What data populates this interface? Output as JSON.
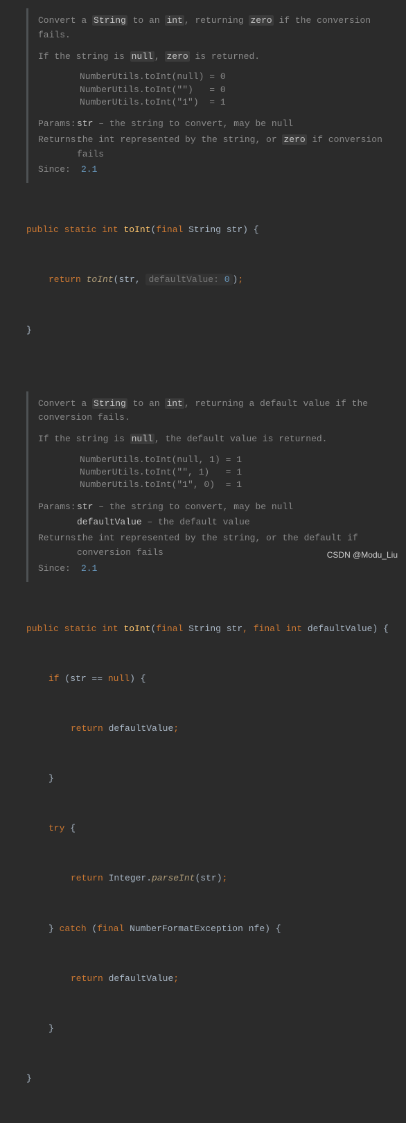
{
  "javadoc1": {
    "desc_a": "Convert a ",
    "desc_b": "String",
    "desc_c": " to an ",
    "desc_d": "int",
    "desc_e": ", returning ",
    "desc_f": "zero",
    "desc_g": " if the conversion fails.",
    "note_a": "If the string is ",
    "note_b": "null",
    "note_c": ", ",
    "note_d": "zero",
    "note_e": " is returned.",
    "codeblock": "NumberUtils.toInt(null) = 0\nNumberUtils.toInt(\"\")   = 0\nNumberUtils.toInt(\"1\")  = 1",
    "params_label": "Params:",
    "param_name": "str",
    "param_desc": " – the string to convert, may be null",
    "returns_label": "Returns:",
    "returns_a": "the int represented by the string, or ",
    "returns_b": "zero",
    "returns_c": " if conversion fails",
    "since_label": "Since:",
    "since_val": "2.1"
  },
  "method1": {
    "sig_public": "public",
    "sig_static": "static",
    "sig_int": "int",
    "sig_name": "toInt",
    "sig_paren_open": "(",
    "sig_final": "final",
    "sig_type": "String",
    "sig_param": "str",
    "sig_paren_close": ")",
    "sig_brace": " {",
    "ret_kw": "return",
    "ret_call": "toInt",
    "ret_open": "(",
    "ret_arg": "str",
    "ret_comma": ", ",
    "hint_label": "defaultValue:",
    "hint_val": "0",
    "ret_close": ")",
    "ret_semi": ";",
    "close_brace": "}"
  },
  "javadoc2": {
    "desc_a": "Convert a ",
    "desc_b": "String",
    "desc_c": " to an ",
    "desc_d": "int",
    "desc_e": ", returning a default value if the conversion fails.",
    "note_a": "If the string is ",
    "note_b": "null",
    "note_c": ", the default value is returned.",
    "codeblock": "NumberUtils.toInt(null, 1) = 1\nNumberUtils.toInt(\"\", 1)   = 1\nNumberUtils.toInt(\"1\", 0)  = 1",
    "params_label": "Params:",
    "param1_name": "str",
    "param1_desc": " – the string to convert, may be null",
    "param2_name": "defaultValue",
    "param2_desc": " – the default value",
    "returns_label": "Returns:",
    "returns_val": "the int represented by the string, or the default if conversion fails",
    "since_label": "Since:",
    "since_val": "2.1"
  },
  "method2": {
    "sig_public": "public",
    "sig_static": "static",
    "sig_int": "int",
    "sig_name": "toInt",
    "sig_paren_open": "(",
    "sig_final1": "final",
    "sig_type1": "String",
    "sig_param1": "str",
    "sig_comma": ",",
    "sig_final2": "final",
    "sig_type2": "int",
    "sig_param2": "defaultValue",
    "sig_paren_close": ")",
    "sig_brace": " {",
    "if_kw": "if",
    "if_open": " (",
    "if_var": "str",
    "if_eq": " == ",
    "if_null": "null",
    "if_close": ")",
    "if_brace": " {",
    "ret1_kw": "return",
    "ret1_val": "defaultValue",
    "ret1_semi": ";",
    "if_close_brace": "}",
    "try_kw": "try",
    "try_brace": " {",
    "ret2_kw": "return",
    "ret2_cls": "Integer",
    "ret2_dot": ".",
    "ret2_method": "parseInt",
    "ret2_open": "(",
    "ret2_arg": "str",
    "ret2_close": ")",
    "ret2_semi": ";",
    "try_close": "}",
    "catch_kw": "catch",
    "catch_open": " (",
    "catch_final": "final",
    "catch_type": "NumberFormatException",
    "catch_var": "nfe",
    "catch_close": ")",
    "catch_brace": " {",
    "ret3_kw": "return",
    "ret3_val": "defaultValue",
    "ret3_semi": ";",
    "catch_close_brace": "}",
    "close_brace": "}"
  },
  "watermark": "CSDN @Modu_Liu"
}
